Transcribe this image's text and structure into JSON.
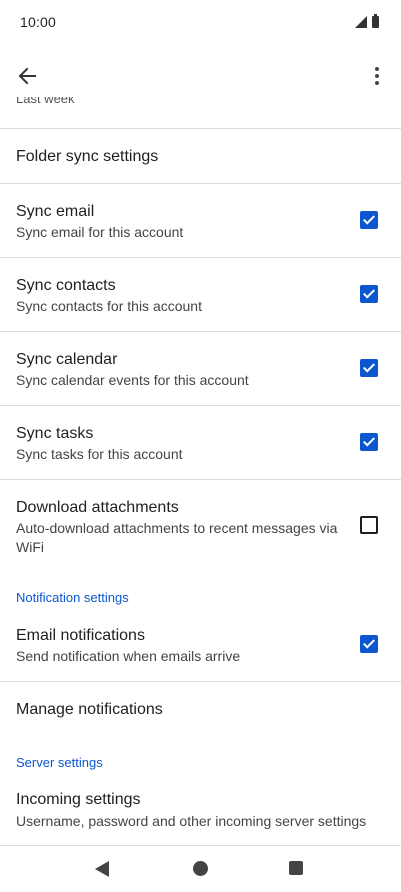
{
  "status_bar": {
    "time": "10:00"
  },
  "partial_text": "Last week",
  "folder_sync": {
    "label": "Folder sync settings"
  },
  "settings": [
    {
      "title": "Sync email",
      "subtitle": "Sync email for this account",
      "checked": true
    },
    {
      "title": "Sync contacts",
      "subtitle": "Sync contacts for this account",
      "checked": true
    },
    {
      "title": "Sync calendar",
      "subtitle": "Sync calendar events for this account",
      "checked": true
    },
    {
      "title": "Sync tasks",
      "subtitle": "Sync tasks for this account",
      "checked": true
    },
    {
      "title": "Download attachments",
      "subtitle": "Auto-download attachments to recent messages via WiFi",
      "checked": false
    }
  ],
  "notification_section": {
    "header": "Notification settings",
    "email_notifications": {
      "title": "Email notifications",
      "subtitle": "Send notification when emails arrive",
      "checked": true
    },
    "manage_label": "Manage notifications"
  },
  "server_section": {
    "header": "Server settings",
    "incoming": {
      "title": "Incoming settings",
      "subtitle": "Username, password and other incoming server settings"
    }
  },
  "colors": {
    "accent": "#0b57d0",
    "divider": "#dcdcdc"
  }
}
